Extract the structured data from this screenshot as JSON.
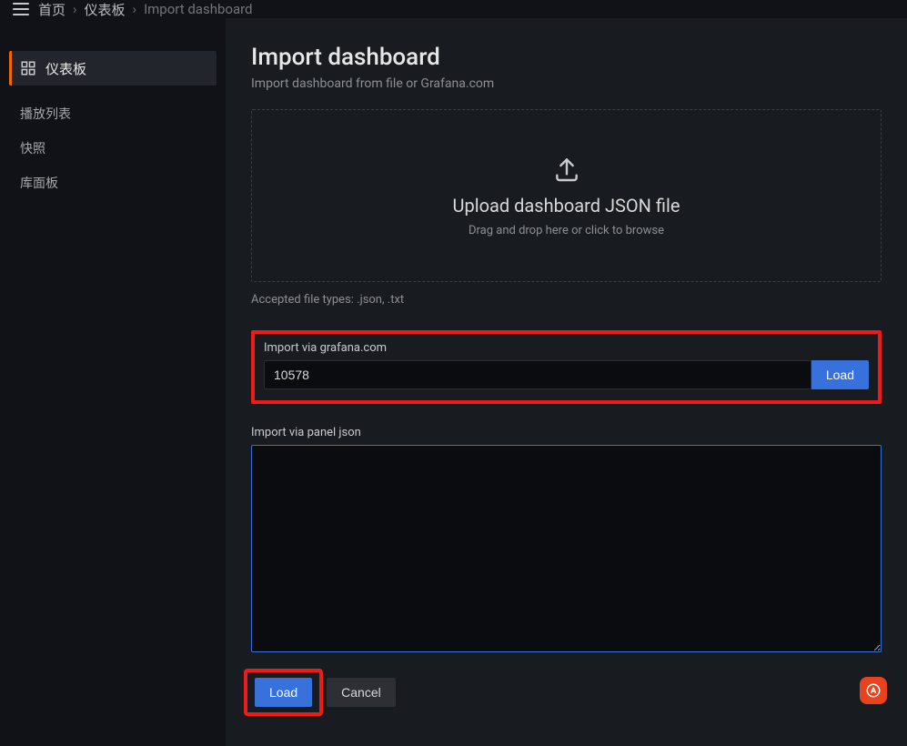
{
  "breadcrumb": {
    "home": "首页",
    "dashboards": "仪表板",
    "current": "Import dashboard"
  },
  "sidebar": {
    "items": [
      {
        "label": "仪表板",
        "active": true
      },
      {
        "label": "播放列表",
        "active": false
      },
      {
        "label": "快照",
        "active": false
      },
      {
        "label": "库面板",
        "active": false
      }
    ]
  },
  "page": {
    "title": "Import dashboard",
    "subtitle": "Import dashboard from file or Grafana.com"
  },
  "dropzone": {
    "title": "Upload dashboard JSON file",
    "hint": "Drag and drop here or click to browse"
  },
  "accepted_hint": "Accepted file types: .json, .txt",
  "grafana_import": {
    "label": "Import via grafana.com",
    "value": "10578",
    "load_label": "Load"
  },
  "panel_json": {
    "label": "Import via panel json",
    "value": ""
  },
  "buttons": {
    "load": "Load",
    "cancel": "Cancel"
  }
}
